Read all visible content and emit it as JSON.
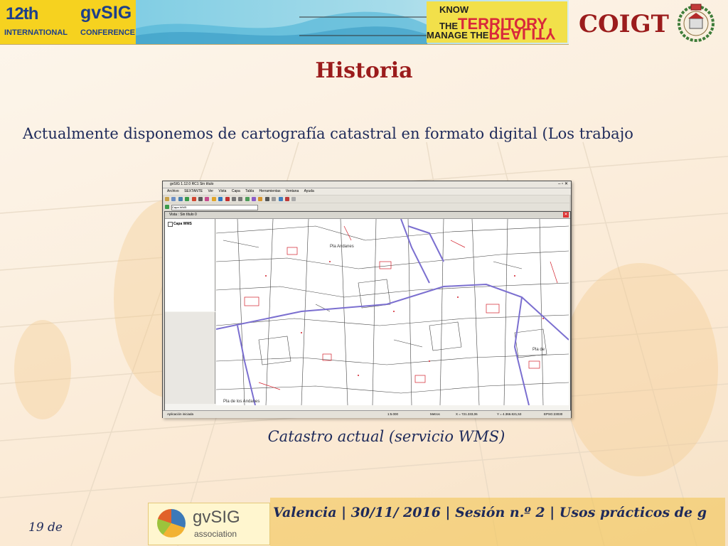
{
  "header": {
    "badge_number": "12th",
    "badge_international": "INTERNATIONAL",
    "badge_gvsig": "gvSIG",
    "badge_conference": "CONFERENCE",
    "slogan_know": "KNOW THE",
    "slogan_territory": "TERRITORY",
    "slogan_manage": "MANAGE THE",
    "slogan_reality": "REALITY",
    "org_name": "COIGT"
  },
  "slide": {
    "title": "Historia",
    "body": "Actualmente disponemos de cartografía catastral en formato digital (Los trabajo",
    "caption": "Catastro actual (servicio WMS)"
  },
  "app": {
    "window_title": "gvSIG 1.12.0 RC1 Sin título",
    "menu": [
      "Archivo",
      "SEXTANTE",
      "Ver",
      "Vista",
      "Capa",
      "Tabla",
      "Herramientas",
      "Ventana",
      "Ayuda"
    ],
    "combo_value": "Capa WMS",
    "view_title": "Vista : Sin título  0",
    "layer_name": "Capa WMS",
    "status_left": "Aplicación iniciada",
    "scale": "1:5.000",
    "units": "Metros",
    "x_coord": "X = 721.333,06",
    "y_coord": "Y = 4.366.821,53",
    "crs": "EPSG:23030",
    "map_labels": [
      "Pla Andanes",
      "Pla de",
      "Pla de los Andanes"
    ]
  },
  "footer": {
    "logo_gv": "gvSIG",
    "logo_assoc": "association",
    "text": "Valencia | 30/11/ 2016 | Sesión n.º 2 | Usos prácticos de g",
    "page": "19 de"
  },
  "colors": {
    "title": "#9b1c1c",
    "body_text": "#1e2a5a",
    "parcel_red": "#d21f2a",
    "road_purple": "#7b6fd0"
  }
}
